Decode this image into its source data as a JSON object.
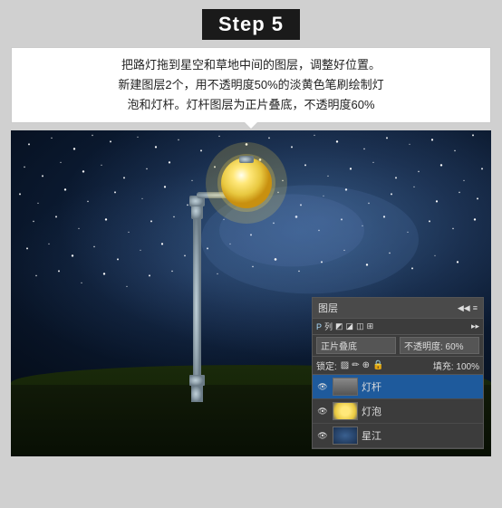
{
  "title": "Step 5",
  "description": "把路灯拖到星空和草地中间的图层，调整好位置。\n新建图层2个，用不透明度50%的淡黄色笔刷绘制灯\n泡和灯杆。灯杆图层为正片叠底，不透明度60%",
  "photoshop_panel": {
    "header_label": "图层",
    "icons": [
      "≡",
      "◀"
    ],
    "panel_icons": [
      "P",
      "列表",
      "◩",
      "◪",
      "◫",
      "⊞"
    ],
    "blend_label": "正片叠底",
    "opacity_label": "不透明度: 60%",
    "lock_label": "锁定:",
    "fill_label": "填充: 100%",
    "layers": [
      {
        "name": "灯杆",
        "visible": true,
        "active": true,
        "thumb": "lamp-post"
      },
      {
        "name": "灯泡",
        "visible": true,
        "active": false,
        "thumb": "globe"
      },
      {
        "name": "星江",
        "visible": true,
        "active": false,
        "thumb": "milky"
      }
    ]
  }
}
